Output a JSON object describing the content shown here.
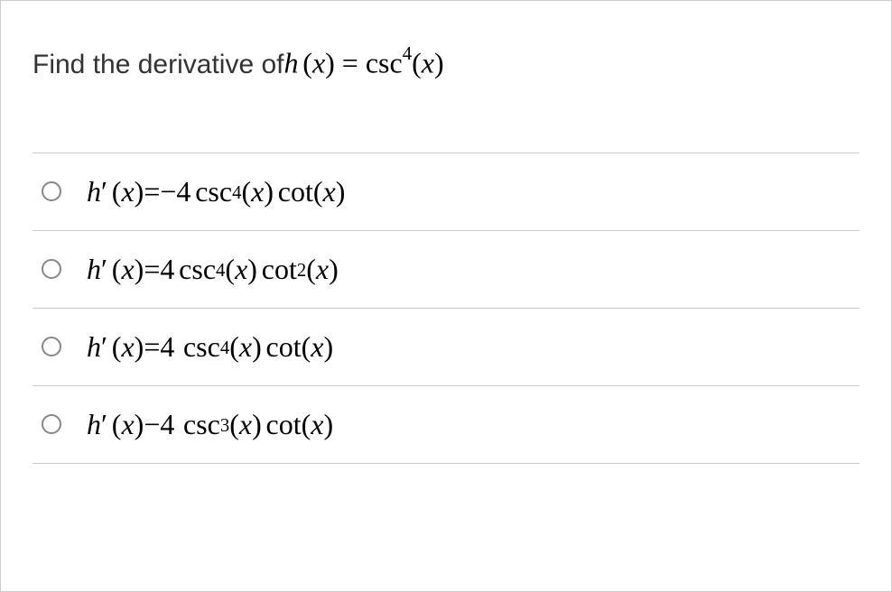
{
  "question": {
    "prompt_text": "Find the derivative of ",
    "function_lhs_h": "h",
    "function_lhs_x": "x",
    "equals": " = ",
    "csc": "csc",
    "exp4": "4",
    "arg_x": "x"
  },
  "options": [
    {
      "h": "h",
      "prime": "′",
      "x_arg": "x",
      "eq": " = ",
      "coef": "−4",
      "csc": "csc",
      "csc_exp": "4",
      "csc_arg": "x",
      "cot": "cot",
      "cot_exp": "",
      "cot_arg": "x"
    },
    {
      "h": "h",
      "prime": "′",
      "x_arg": "x",
      "eq": " = ",
      "coef": "4",
      "csc": "csc",
      "csc_exp": "4",
      "csc_arg": "x",
      "cot": "cot",
      "cot_exp": "2",
      "cot_arg": "x"
    },
    {
      "h": "h",
      "prime": "′",
      "x_arg": "x",
      "eq": " = ",
      "coef": "4 ",
      "csc": "csc",
      "csc_exp": "4",
      "csc_arg": "x",
      "cot": "cot",
      "cot_exp": "",
      "cot_arg": "x"
    },
    {
      "h": "h",
      "prime": "′",
      "x_arg": "x",
      "eq": " − ",
      "coef": "4 ",
      "csc": "csc",
      "csc_exp": "3",
      "csc_arg": "x",
      "cot": "cot",
      "cot_exp": "",
      "cot_arg": "x"
    }
  ]
}
